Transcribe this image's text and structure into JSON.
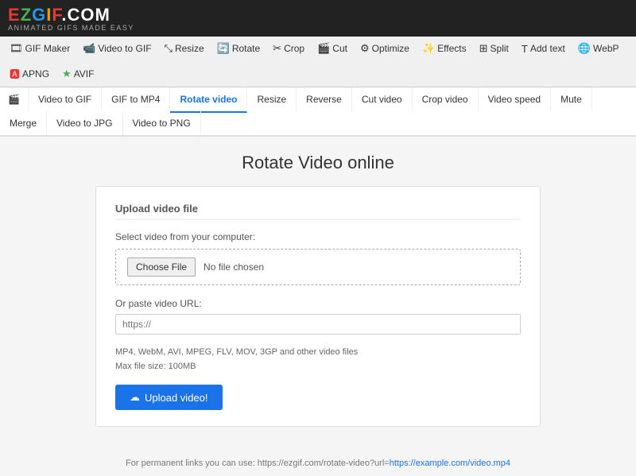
{
  "logo": {
    "text": "EZGIF.COM",
    "subtitle": "ANIMATED GIFS MADE EASY"
  },
  "main_nav": {
    "items": [
      {
        "id": "gif-maker",
        "icon": "🎞",
        "label": "GIF Maker"
      },
      {
        "id": "video-to-gif",
        "icon": "📹",
        "label": "Video to GIF"
      },
      {
        "id": "resize",
        "icon": "✂",
        "label": "Resize"
      },
      {
        "id": "rotate",
        "icon": "🔄",
        "label": "Rotate"
      },
      {
        "id": "crop",
        "icon": "✂",
        "label": "Crop"
      },
      {
        "id": "cut",
        "icon": "🎬",
        "label": "Cut"
      },
      {
        "id": "optimize",
        "icon": "⚙",
        "label": "Optimize"
      },
      {
        "id": "effects",
        "icon": "✨",
        "label": "Effects"
      },
      {
        "id": "split",
        "icon": "⊞",
        "label": "Split"
      },
      {
        "id": "add-text",
        "icon": "T",
        "label": "Add text"
      },
      {
        "id": "webp",
        "icon": "🌐",
        "label": "WebP"
      },
      {
        "id": "apng",
        "icon": "🅰",
        "label": "APNG"
      },
      {
        "id": "avif",
        "icon": "★",
        "label": "AVIF"
      }
    ]
  },
  "sub_nav": {
    "items": [
      {
        "id": "video-icon",
        "icon": "🎬",
        "label": ""
      },
      {
        "id": "video-to-gif-sub",
        "label": "Video to GIF"
      },
      {
        "id": "gif-to-mp4",
        "label": "GIF to MP4"
      },
      {
        "id": "rotate-video",
        "label": "Rotate video",
        "active": true
      },
      {
        "id": "resize-sub",
        "label": "Resize"
      },
      {
        "id": "reverse",
        "label": "Reverse"
      },
      {
        "id": "cut-video",
        "label": "Cut video"
      },
      {
        "id": "crop-video",
        "label": "Crop video"
      },
      {
        "id": "video-speed",
        "label": "Video speed"
      },
      {
        "id": "mute",
        "label": "Mute"
      },
      {
        "id": "merge",
        "label": "Merge"
      },
      {
        "id": "video-to-jpg",
        "label": "Video to JPG"
      },
      {
        "id": "video-to-png",
        "label": "Video to PNG"
      }
    ]
  },
  "page": {
    "title": "Rotate Video online"
  },
  "upload_card": {
    "section_title": "Upload video file",
    "file_label": "Select video from your computer:",
    "choose_btn": "Choose File",
    "no_file_text": "No file chosen",
    "url_label": "Or paste video URL:",
    "url_placeholder": "https://",
    "format_info_line1": "MP4, WebM, AVI, MPEG, FLV, MOV, 3GP and other video files",
    "format_info_line2": "Max file size: 100MB",
    "upload_btn": "Upload video!"
  },
  "footer": {
    "text": "For permanent links you can use: https://ezgif.com/rotate-video?url=",
    "link_text": "https://example.com/video.mp4",
    "link_href": "https://example.com/video.mp4"
  }
}
